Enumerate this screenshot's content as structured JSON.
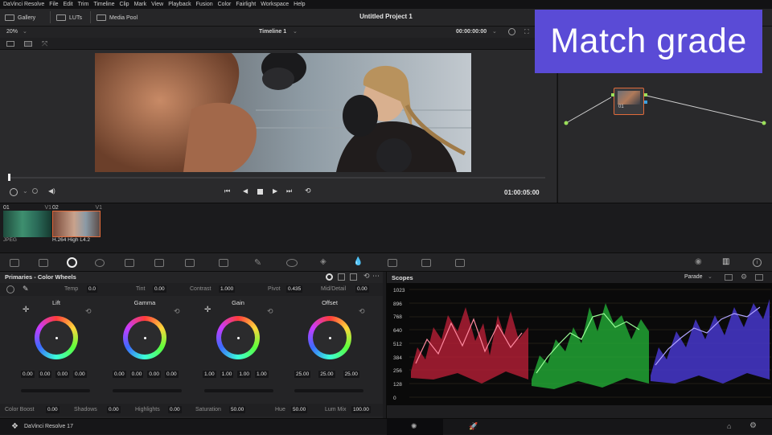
{
  "menu": [
    "DaVinci Resolve",
    "File",
    "Edit",
    "Trim",
    "Timeline",
    "Clip",
    "Mark",
    "View",
    "Playback",
    "Fusion",
    "Color",
    "Fairlight",
    "Workspace",
    "Help"
  ],
  "tabs": {
    "gallery": "Gallery",
    "luts": "LUTs",
    "media_pool": "Media Pool"
  },
  "project_title": "Untitled Project 1",
  "viewer": {
    "zoom": "20%",
    "timeline": "Timeline 1",
    "timecode_top": "00:00:00:00",
    "timecode": "01:00:05:00"
  },
  "overlay": {
    "text": "Match grade"
  },
  "node": {
    "label": "01"
  },
  "clips": [
    {
      "num": "01",
      "track": "V1",
      "codec": "JPEG"
    },
    {
      "num": "02",
      "track": "V1",
      "codec": "H.264 High L4.2"
    }
  ],
  "primaries": {
    "title": "Primaries - Color Wheels",
    "temp": {
      "label": "Temp",
      "value": "0.0"
    },
    "tint": {
      "label": "Tint",
      "value": "0.00"
    },
    "contrast": {
      "label": "Contrast",
      "value": "1.000"
    },
    "pivot": {
      "label": "Pivot",
      "value": "0.435"
    },
    "middetail": {
      "label": "Mid/Detail",
      "value": "0.00"
    },
    "wheels": [
      {
        "name": "Lift",
        "values": [
          "0.00",
          "0.00",
          "0.00",
          "0.00"
        ]
      },
      {
        "name": "Gamma",
        "values": [
          "0.00",
          "0.00",
          "0.00",
          "0.00"
        ]
      },
      {
        "name": "Gain",
        "values": [
          "1.00",
          "1.00",
          "1.00",
          "1.00"
        ]
      },
      {
        "name": "Offset",
        "values": [
          "25.00",
          "25.00",
          "25.00"
        ]
      }
    ],
    "color_boost": {
      "label": "Color Boost",
      "value": "0.00"
    },
    "shadows": {
      "label": "Shadows",
      "value": "0.00"
    },
    "highlights": {
      "label": "Highlights",
      "value": "0.00"
    },
    "saturation": {
      "label": "Saturation",
      "value": "50.00"
    },
    "hue": {
      "label": "Hue",
      "value": "50.00"
    },
    "lummix": {
      "label": "Lum Mix",
      "value": "100.00"
    }
  },
  "scopes": {
    "title": "Scopes",
    "mode": "Parade",
    "scale": [
      "1023",
      "896",
      "768",
      "640",
      "512",
      "384",
      "256",
      "128",
      "0"
    ]
  },
  "status": {
    "app": "DaVinci Resolve 17"
  },
  "colors": {
    "accent": "#5a4bd6",
    "node_green": "#9be05a",
    "highlight_orange": "#e06a3a"
  }
}
